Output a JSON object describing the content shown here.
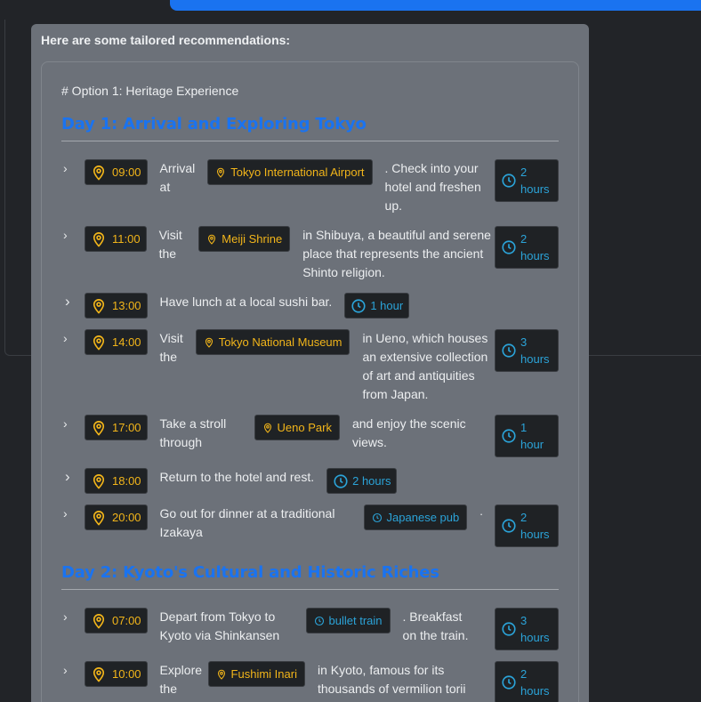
{
  "intro": "Here are some tailored recommendations:",
  "option_title": "# Option 1: Heritage Experience",
  "days": [
    {
      "title": "Day 1: Arrival and Exploring Tokyo",
      "activities": [
        {
          "time": "09:00",
          "pre": "Arrival at",
          "place": "Tokyo International Airport",
          "post": ". Check into your hotel and freshen up.",
          "duration": "2 hours"
        },
        {
          "time": "11:00",
          "pre": "Visit the",
          "place": "Meiji Shrine",
          "post": "in Shibuya, a beautiful and serene place that represents the ancient Shinto religion.",
          "duration": "2 hours"
        },
        {
          "time": "13:00",
          "pre": "Have lunch at a local sushi bar.",
          "duration": "1 hour"
        },
        {
          "time": "14:00",
          "pre": "Visit the",
          "place": "Tokyo National Museum",
          "post": "in Ueno, which houses an extensive collection of art and antiquities from Japan.",
          "duration": "3 hours"
        },
        {
          "time": "17:00",
          "pre": "Take a stroll through",
          "place": "Ueno Park",
          "post": "and enjoy the scenic views.",
          "duration": "1 hour"
        },
        {
          "time": "18:00",
          "pre": "Return to the hotel and rest.",
          "duration": "2 hours"
        },
        {
          "time": "20:00",
          "pre": "Go out for dinner at a traditional Izakaya",
          "place": "Japanese pub",
          "post": ".",
          "duration": "2 hours"
        }
      ]
    },
    {
      "title": "Day 2: Kyoto's Cultural and Historic Riches",
      "activities": [
        {
          "time": "07:00",
          "pre": "Depart from Tokyo to Kyoto via Shinkansen",
          "place": "bullet train",
          "post": ". Breakfast on the train.",
          "duration": "3 hours"
        },
        {
          "time": "10:00",
          "pre": "Explore the",
          "place": "Fushimi Inari",
          "post": "in Kyoto, famous for its thousands of vermilion torii",
          "duration": "2 hours"
        }
      ]
    }
  ],
  "colors": {
    "accent": "#1a73f0",
    "time": "#f2b51a",
    "duration": "#2ba3d8",
    "bubble": "#6c7179"
  }
}
